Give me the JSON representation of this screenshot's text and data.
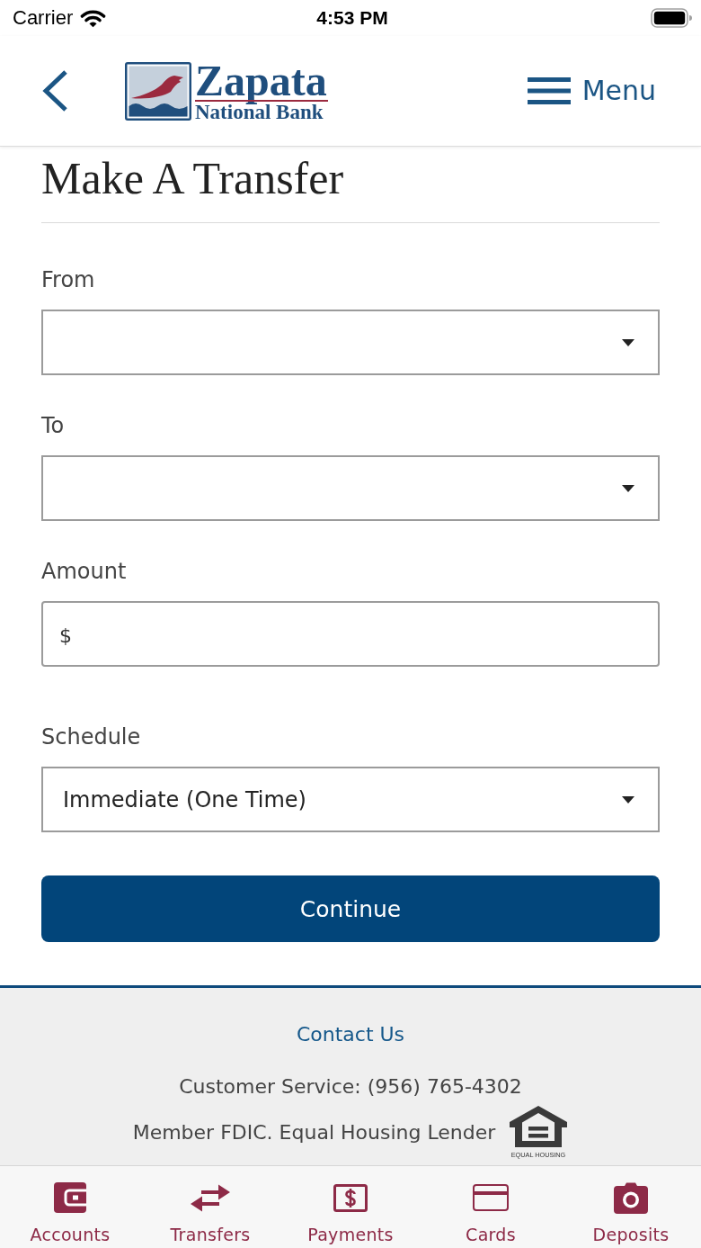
{
  "status_bar": {
    "carrier": "Carrier",
    "time": "4:53 PM"
  },
  "header": {
    "logo": {
      "wordmark": "Zapata",
      "tagline": "National Bank"
    },
    "menu_label": "Menu"
  },
  "title": "Make A Transfer",
  "form": {
    "fields": [
      {
        "kind": "select",
        "label": "From"
      },
      {
        "kind": "select",
        "label": "To"
      },
      {
        "kind": "amount",
        "label": "Amount",
        "prefix": "$"
      },
      {
        "kind": "select",
        "label": "Schedule",
        "value": "Immediate (One Time)"
      }
    ],
    "submit_label": "Continue"
  },
  "footer": {
    "contact_link": "Contact Us",
    "customer_service": "Customer Service: (956) 765-4302",
    "member_notice": "Member FDIC. Equal Housing Lender",
    "housing_logo_caption": "EQUAL HOUSING"
  },
  "tab_bar": {
    "items": [
      {
        "label": "Accounts"
      },
      {
        "label": "Transfers"
      },
      {
        "label": "Payments"
      },
      {
        "label": "Cards"
      },
      {
        "label": "Deposits"
      }
    ]
  }
}
